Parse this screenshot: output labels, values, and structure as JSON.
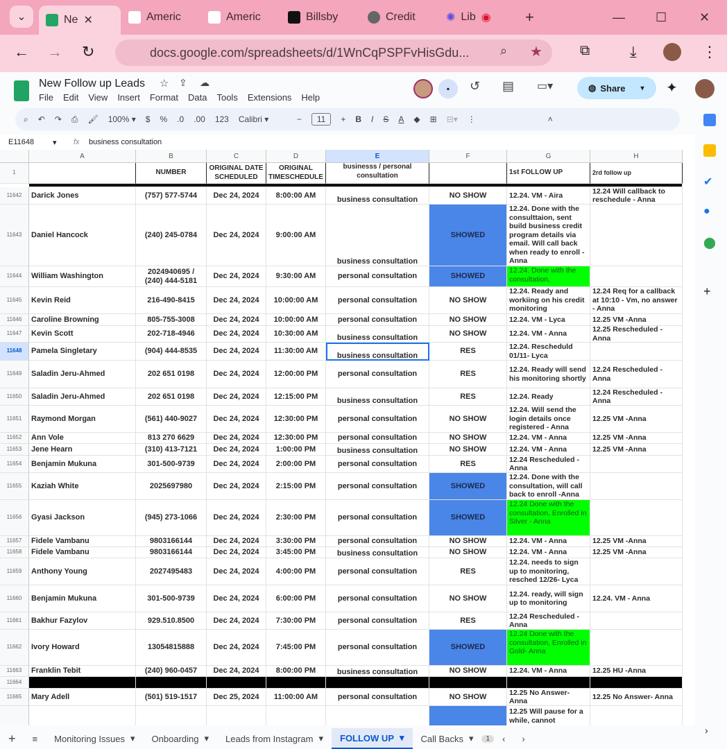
{
  "browser": {
    "tabs": [
      "Ne",
      "Americ",
      "Americ",
      "Billsby",
      "Credit",
      "Lib"
    ],
    "url": "docs.google.com/spreadsheets/d/1WnCqPSPFvHisGdu..."
  },
  "doc": {
    "title": "New Follow up Leads",
    "menu": [
      "File",
      "Edit",
      "View",
      "Insert",
      "Format",
      "Data",
      "Tools",
      "Extensions",
      "Help"
    ],
    "share": "Share"
  },
  "toolbar": {
    "zoom": "100%",
    "currency": "$",
    "percent": "%",
    "dec_less": ".0",
    "dec_more": ".00",
    "format": "123",
    "font": "Calibri",
    "size": "11"
  },
  "formula": {
    "cell_ref": "E11648",
    "fx": "fx",
    "value": "business consultation"
  },
  "columns": [
    "A",
    "B",
    "C",
    "D",
    "E",
    "F",
    "G",
    "H"
  ],
  "header_row": {
    "num": "1",
    "cells": [
      "",
      "NUMBER",
      "ORIGINAL DATE SCHEDULED",
      "ORIGINAL TIMESCHEDULE",
      "businesss / personal consultation",
      "",
      "1st FOLLOW UP",
      "2rd follow up"
    ]
  },
  "colors": {
    "showed": "#4a86e8",
    "enrolled": "#00ff00",
    "enrolled_text": "#1a5c1a"
  },
  "rows": [
    {
      "n": "11642",
      "a": "Darick Jones",
      "b": "(757) 577-5744",
      "c": "Dec 24, 2024",
      "d": "8:00:00 AM",
      "e": "business consultation",
      "f": "NO SHOW",
      "g": "12.24. VM - Aira",
      "h": "12.24 Will callback to reschedule - Anna"
    },
    {
      "n": "11643",
      "a": "Daniel Hancock",
      "b": "(240) 245-0784",
      "c": "Dec 24, 2024",
      "d": "9:00:00 AM",
      "e": "business consultation",
      "f": "SHOWED",
      "g": "12.24. Done with the consulttaion, sent build business credit program details via email. Will call back when ready to  enroll - Anna",
      "h": ""
    },
    {
      "n": "11644",
      "a": "William Washington",
      "b": "2024940695 / (240) 444-5181",
      "c": "Dec 24, 2024",
      "d": "9:30:00 AM",
      "e": "personal consultation",
      "f": "SHOWED",
      "g": "12.24. Done with the consultation,",
      "h": "",
      "green": true
    },
    {
      "n": "11645",
      "a": "Kevin Reid",
      "b": "216-490-8415",
      "c": "Dec 24, 2024",
      "d": "10:00:00 AM",
      "e": "personal consultation",
      "f": "NO SHOW",
      "g": "12.24. Ready and workiing on his credit monitoring",
      "h": "12.24 Req for a callback at 10:10 - Vm, no answer - Anna"
    },
    {
      "n": "11646",
      "a": "Caroline Browning",
      "b": "805-755-3008",
      "c": "Dec 24, 2024",
      "d": "10:00:00 AM",
      "e": "personal consultation",
      "f": "NO SHOW",
      "g": "12.24. VM - Lyca",
      "h": "12.25 VM -Anna"
    },
    {
      "n": "11647",
      "a": "Kevin Scott",
      "b": "202-718-4946",
      "c": "Dec 24, 2024",
      "d": "10:30:00 AM",
      "e": "business consultation",
      "f": "NO SHOW",
      "g": "12.24. VM - Anna",
      "h": "12.25 Rescheduled - Anna"
    },
    {
      "n": "11648",
      "a": "Pamela Singletary",
      "b": "(904) 444-8535",
      "c": "Dec 24, 2024",
      "d": "11:30:00 AM",
      "e": "business consultation",
      "f": "RES",
      "g": "12.24. Rescheduld 01/11- Lyca",
      "h": "",
      "sel": true
    },
    {
      "n": "11649",
      "a": "Saladin Jeru-Ahmed",
      "b": "202 651 0198",
      "c": "Dec 24, 2024",
      "d": "12:00:00 PM",
      "e": "personal consultation",
      "f": "RES",
      "g": "12.24. Ready will send his monitoring shortly",
      "h": "12.24 Rescheduled -Anna"
    },
    {
      "n": "11650",
      "a": "Saladin Jeru-Ahmed",
      "b": "202 651 0198",
      "c": "Dec 24, 2024",
      "d": "12:15:00 PM",
      "e": "business consultation",
      "f": "RES",
      "g": "12.24.  Ready",
      "h": "12.24 Rescheduled -Anna"
    },
    {
      "n": "11651",
      "a": "Raymond Morgan",
      "b": "(561) 440-9027",
      "c": "Dec 24, 2024",
      "d": "12:30:00 PM",
      "e": "personal consultation",
      "f": "NO SHOW",
      "g": "12.24.  Will send the login details once registered - Anna",
      "h": "12.25 VM -Anna"
    },
    {
      "n": "11652",
      "a": "Ann Vole",
      "b": "813 270 6629",
      "c": "Dec 24, 2024",
      "d": "12:30:00 PM",
      "e": "personal consultation",
      "f": "NO SHOW",
      "g": "12.24. VM - Anna",
      "h": "12.25 VM -Anna"
    },
    {
      "n": "11653",
      "a": "Jene Hearn",
      "b": "(310) 413-7121",
      "c": "Dec 24, 2024",
      "d": "1:00:00 PM",
      "e": "business consultation",
      "f": "NO SHOW",
      "g": "12.24. VM - Anna",
      "h": "12.25 VM -Anna"
    },
    {
      "n": "11654",
      "a": "Benjamin Mukuna",
      "b": "301-500-9739",
      "c": "Dec 24, 2024",
      "d": "2:00:00 PM",
      "e": "personal consultation",
      "f": "RES",
      "g": "12.24 Rescheduled -Anna",
      "h": ""
    },
    {
      "n": "11655",
      "a": "Kaziah White",
      "b": "2025697980",
      "c": "Dec 24, 2024",
      "d": "2:15:00 PM",
      "e": "personal consultation",
      "f": "SHOWED",
      "g": "12.24. Done with the consultation, will call back to enroll -Anna",
      "h": ""
    },
    {
      "n": "11656",
      "a": "Gyasi Jackson",
      "b": "(945) 273-1066",
      "c": "Dec 24, 2024",
      "d": "2:30:00 PM",
      "e": "personal consultation",
      "f": "SHOWED",
      "g": "12.24 Done with the consultation, Enrolled in Silver - Anna",
      "h": "",
      "green": true
    },
    {
      "n": "11657",
      "a": "Fidele Vambanu",
      "b": "9803166144",
      "c": "Dec 24, 2024",
      "d": "3:30:00 PM",
      "e": "personal consultation",
      "f": "NO SHOW",
      "g": "12.24. VM - Anna",
      "h": "12.25 VM -Anna"
    },
    {
      "n": "11658",
      "a": "Fidele Vambanu",
      "b": "9803166144",
      "c": "Dec 24, 2024",
      "d": "3:45:00 PM",
      "e": "business consultation",
      "f": "NO SHOW",
      "g": "12.24. VM - Anna",
      "h": "12.25 VM -Anna"
    },
    {
      "n": "11659",
      "a": "Anthony Young",
      "b": "2027495483",
      "c": "Dec 24, 2024",
      "d": "4:00:00 PM",
      "e": "personal consultation",
      "f": "RES",
      "g": "12.24. needs to sign up to monitoring, resched 12/26- Lyca",
      "h": ""
    },
    {
      "n": "11660",
      "a": "Benjamin Mukuna",
      "b": "301-500-9739",
      "c": "Dec 24, 2024",
      "d": "6:00:00 PM",
      "e": "personal consultation",
      "f": "NO SHOW",
      "g": "12.24. ready, will sign up to monitoring",
      "h": "12.24. VM - Anna"
    },
    {
      "n": "11661",
      "a": "Bakhur Fazylov",
      "b": "929.510.8500",
      "c": "Dec 24, 2024",
      "d": "7:30:00 PM",
      "e": "personal consultation",
      "f": "RES",
      "g": "12.24 Rescheduled -Anna",
      "h": ""
    },
    {
      "n": "11662",
      "a": "Ivory Howard",
      "b": "13054815888",
      "c": "Dec 24, 2024",
      "d": "7:45:00 PM",
      "e": "personal consultation",
      "f": "SHOWED",
      "g": "12.24 Done with the consultation, Enrolled in Gold- Anna",
      "h": "",
      "green": true
    },
    {
      "n": "11663",
      "a": "Franklin Tebit",
      "b": "(240) 960-0457",
      "c": "Dec 24, 2024",
      "d": "8:00:00 PM",
      "e": "business consultation",
      "f": "NO SHOW",
      "g": "12.24. VM - Anna",
      "h": "12.25 HU -Anna"
    },
    {
      "n": "11664",
      "a": "",
      "b": "",
      "c": "",
      "d": "",
      "e": "",
      "f": "",
      "g": "",
      "h": "",
      "black": true
    },
    {
      "n": "11665",
      "a": "Mary Adell",
      "b": "(501) 519-1517",
      "c": "Dec 25, 2024",
      "d": "11:00:00 AM",
      "e": "personal consultation",
      "f": "NO SHOW",
      "g": "12.25 No Answer- Anna",
      "h": "12.25 No Answer- Anna"
    },
    {
      "n": "",
      "a": "",
      "b": "",
      "c": "",
      "d": "",
      "e": "",
      "f": "SHOWED_BLANK",
      "g": "12.25 Will pause for a while, cannot",
      "h": ""
    }
  ],
  "sheets": [
    "Monitoring Issues",
    "Onboarding",
    "Leads from Instagram",
    "FOLLOW UP",
    "Call Backs"
  ],
  "sheet_badge": "1"
}
